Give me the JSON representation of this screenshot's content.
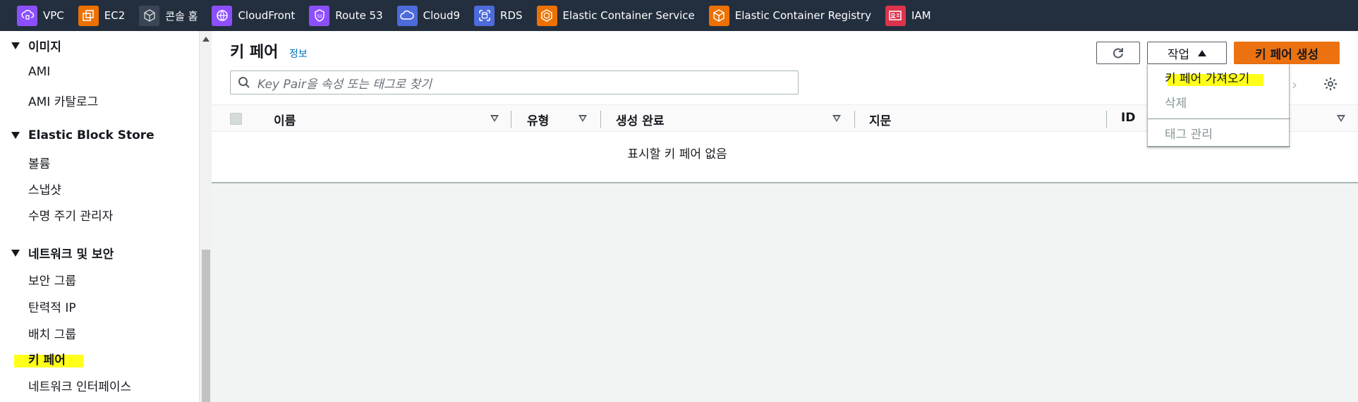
{
  "favorites": [
    {
      "label": "VPC",
      "icon": "vpc-icon",
      "color": "#8c4fff"
    },
    {
      "label": "EC2",
      "icon": "ec2-icon",
      "color": "#ed7100"
    },
    {
      "label": "콘솔 홈",
      "icon": "cube-icon",
      "color": "#3a4655"
    },
    {
      "label": "CloudFront",
      "icon": "cloudfront-icon",
      "color": "#8c4fff"
    },
    {
      "label": "Route 53",
      "icon": "route53-icon",
      "color": "#8c4fff"
    },
    {
      "label": "Cloud9",
      "icon": "cloud9-icon",
      "color": "#4d6bdb"
    },
    {
      "label": "RDS",
      "icon": "rds-icon",
      "color": "#4d6bdb"
    },
    {
      "label": "Elastic Container Service",
      "icon": "ecs-icon",
      "color": "#ed7100"
    },
    {
      "label": "Elastic Container Registry",
      "icon": "ecr-icon",
      "color": "#ed7100"
    },
    {
      "label": "IAM",
      "icon": "iam-icon",
      "color": "#dd344c"
    }
  ],
  "sidebar": {
    "sections": [
      {
        "title": "이미지",
        "items": [
          "AMI",
          "AMI 카탈로그"
        ]
      },
      {
        "title": "Elastic Block Store",
        "items": [
          "볼륨",
          "스냅샷",
          "수명 주기 관리자"
        ]
      },
      {
        "title": "네트워크 및 보안",
        "items": [
          "보안 그룹",
          "탄력적 IP",
          "배치 그룹",
          "키 페어",
          "네트워크 인터페이스"
        ]
      }
    ]
  },
  "main": {
    "title": "키 페어",
    "info": "정보",
    "search_placeholder": "Key Pair을 속성 또는  태그로 찾기",
    "action_label": "작업",
    "create_label": "키 페어 생성",
    "columns": [
      "이름",
      "유형",
      "생성 완료",
      "지문",
      "ID"
    ],
    "empty_message": "표시할 키 페어 없음",
    "menu": {
      "import": "키 페어 가져오기",
      "delete": "삭제",
      "manage_tags": "태그 관리"
    }
  },
  "colors": {
    "nav_bg": "#232f3e",
    "accent": "#ec7211",
    "link": "#0073bb",
    "highlight": "#ffff1a"
  }
}
